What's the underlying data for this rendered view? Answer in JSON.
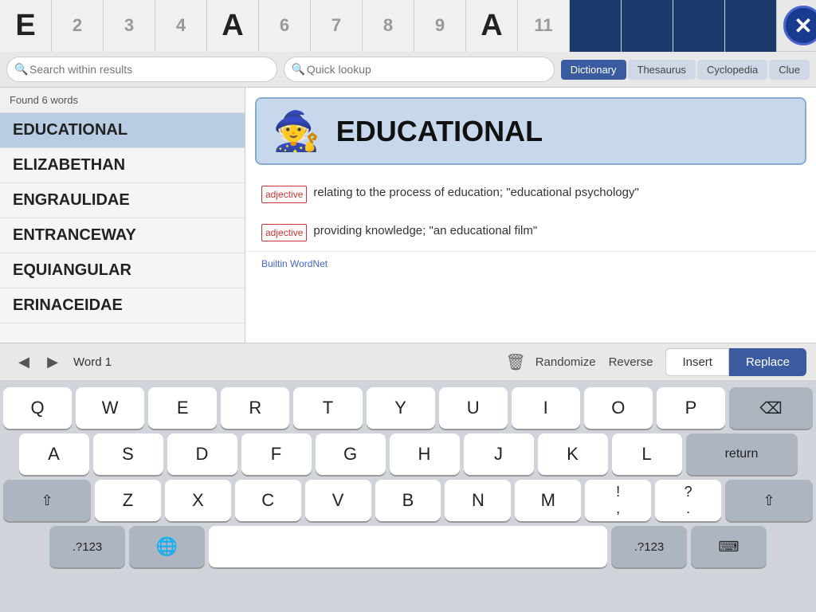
{
  "topBar": {
    "tiles": [
      {
        "label": "E",
        "type": "letter-large"
      },
      {
        "label": "2",
        "type": "number"
      },
      {
        "label": "3",
        "type": "number"
      },
      {
        "label": "4",
        "type": "number"
      },
      {
        "label": "A",
        "type": "letter-large"
      },
      {
        "label": "6",
        "type": "number"
      },
      {
        "label": "7",
        "type": "number"
      },
      {
        "label": "8",
        "type": "number"
      },
      {
        "label": "9",
        "type": "number"
      },
      {
        "label": "A",
        "type": "letter-large"
      },
      {
        "label": "11",
        "type": "number"
      },
      {
        "label": "",
        "type": "dark"
      },
      {
        "label": "",
        "type": "dark"
      },
      {
        "label": "",
        "type": "dark"
      },
      {
        "label": "",
        "type": "dark"
      }
    ],
    "close_label": "✕"
  },
  "searchBar": {
    "left_placeholder": "Search within results",
    "right_placeholder": "Quick lookup",
    "dict_buttons": [
      {
        "label": "Dictionary",
        "active": true
      },
      {
        "label": "Thesaurus",
        "active": false
      },
      {
        "label": "Cyclopedia",
        "active": false
      },
      {
        "label": "Clue",
        "active": false
      }
    ]
  },
  "wordList": {
    "found_text": "Found 6 words",
    "words": [
      {
        "text": "EDUCATIONAL",
        "selected": true
      },
      {
        "text": "ELIZABETHAN",
        "selected": false
      },
      {
        "text": "ENGRAULIDAE",
        "selected": false
      },
      {
        "text": "ENTRANCEWAY",
        "selected": false
      },
      {
        "text": "EQUIANGULAR",
        "selected": false
      },
      {
        "text": "ERINACEIDAE",
        "selected": false
      }
    ]
  },
  "definition": {
    "word": "EDUCATIONAL",
    "wizard_icon": "🎩",
    "entries": [
      {
        "pos": "adjective",
        "text": "relating to the process of education; \"educational psychology\""
      },
      {
        "pos": "adjective",
        "text": "providing knowledge; \"an educational film\""
      }
    ],
    "source": "Builtin WordNet"
  },
  "toolbar": {
    "prev_arrow": "◀",
    "next_arrow": "▶",
    "word_label": "Word 1",
    "trash_icon": "🗑",
    "randomize_label": "Randomize",
    "reverse_label": "Reverse",
    "insert_label": "Insert",
    "replace_label": "Replace"
  },
  "keyboard": {
    "row1": [
      "Q",
      "W",
      "E",
      "R",
      "T",
      "Y",
      "U",
      "I",
      "O",
      "P"
    ],
    "row2": [
      "A",
      "S",
      "D",
      "F",
      "G",
      "H",
      "J",
      "K",
      "L"
    ],
    "row3": [
      "Z",
      "X",
      "C",
      "V",
      "B",
      "N",
      "M",
      "!,",
      "?."
    ],
    "shift_label": "⇧",
    "backspace_label": "⌫",
    "return_label": "return",
    "num_sym_label": ".?123",
    "globe_label": "🌐",
    "space_label": "",
    "dismiss_label": "⌨"
  }
}
